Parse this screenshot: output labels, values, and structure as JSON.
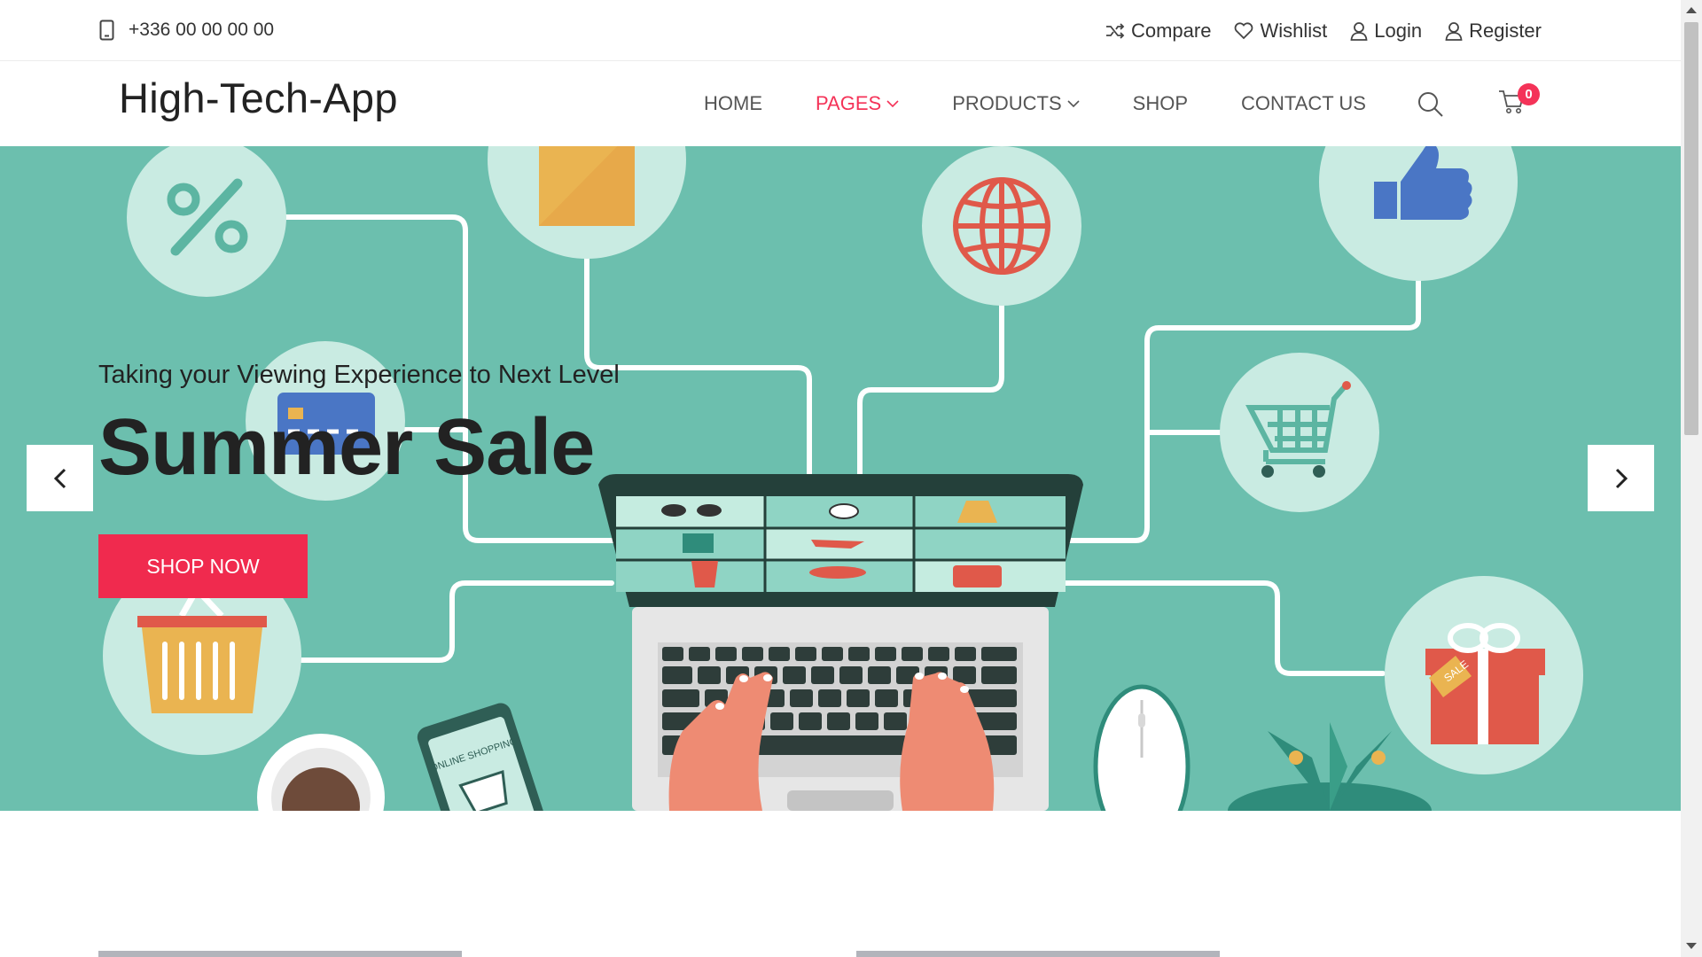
{
  "topbar": {
    "phone": "+336 00 00 00 00",
    "links": [
      {
        "label": "Compare",
        "icon": "shuffle-icon"
      },
      {
        "label": "Wishlist",
        "icon": "heart-icon"
      },
      {
        "label": "Login",
        "icon": "user-icon"
      },
      {
        "label": "Register",
        "icon": "user-icon"
      }
    ]
  },
  "header": {
    "logo": "High-Tech-App",
    "nav": [
      {
        "label": "HOME"
      },
      {
        "label": "PAGES"
      },
      {
        "label": "PRODUCTS"
      },
      {
        "label": "SHOP"
      },
      {
        "label": "CONTACT US"
      }
    ],
    "active_nav": "PAGES",
    "cart_count": "0"
  },
  "hero": {
    "subtitle": "Taking your Viewing Experience to Next Level",
    "title": "Summer Sale",
    "button": "SHOP NOW",
    "background": "#6cbfae",
    "illustration_text": {
      "phone": "ONLINE SHOPPING",
      "tag": "SALE"
    }
  },
  "colors": {
    "accent": "#f43358",
    "button": "#f02a4e"
  }
}
